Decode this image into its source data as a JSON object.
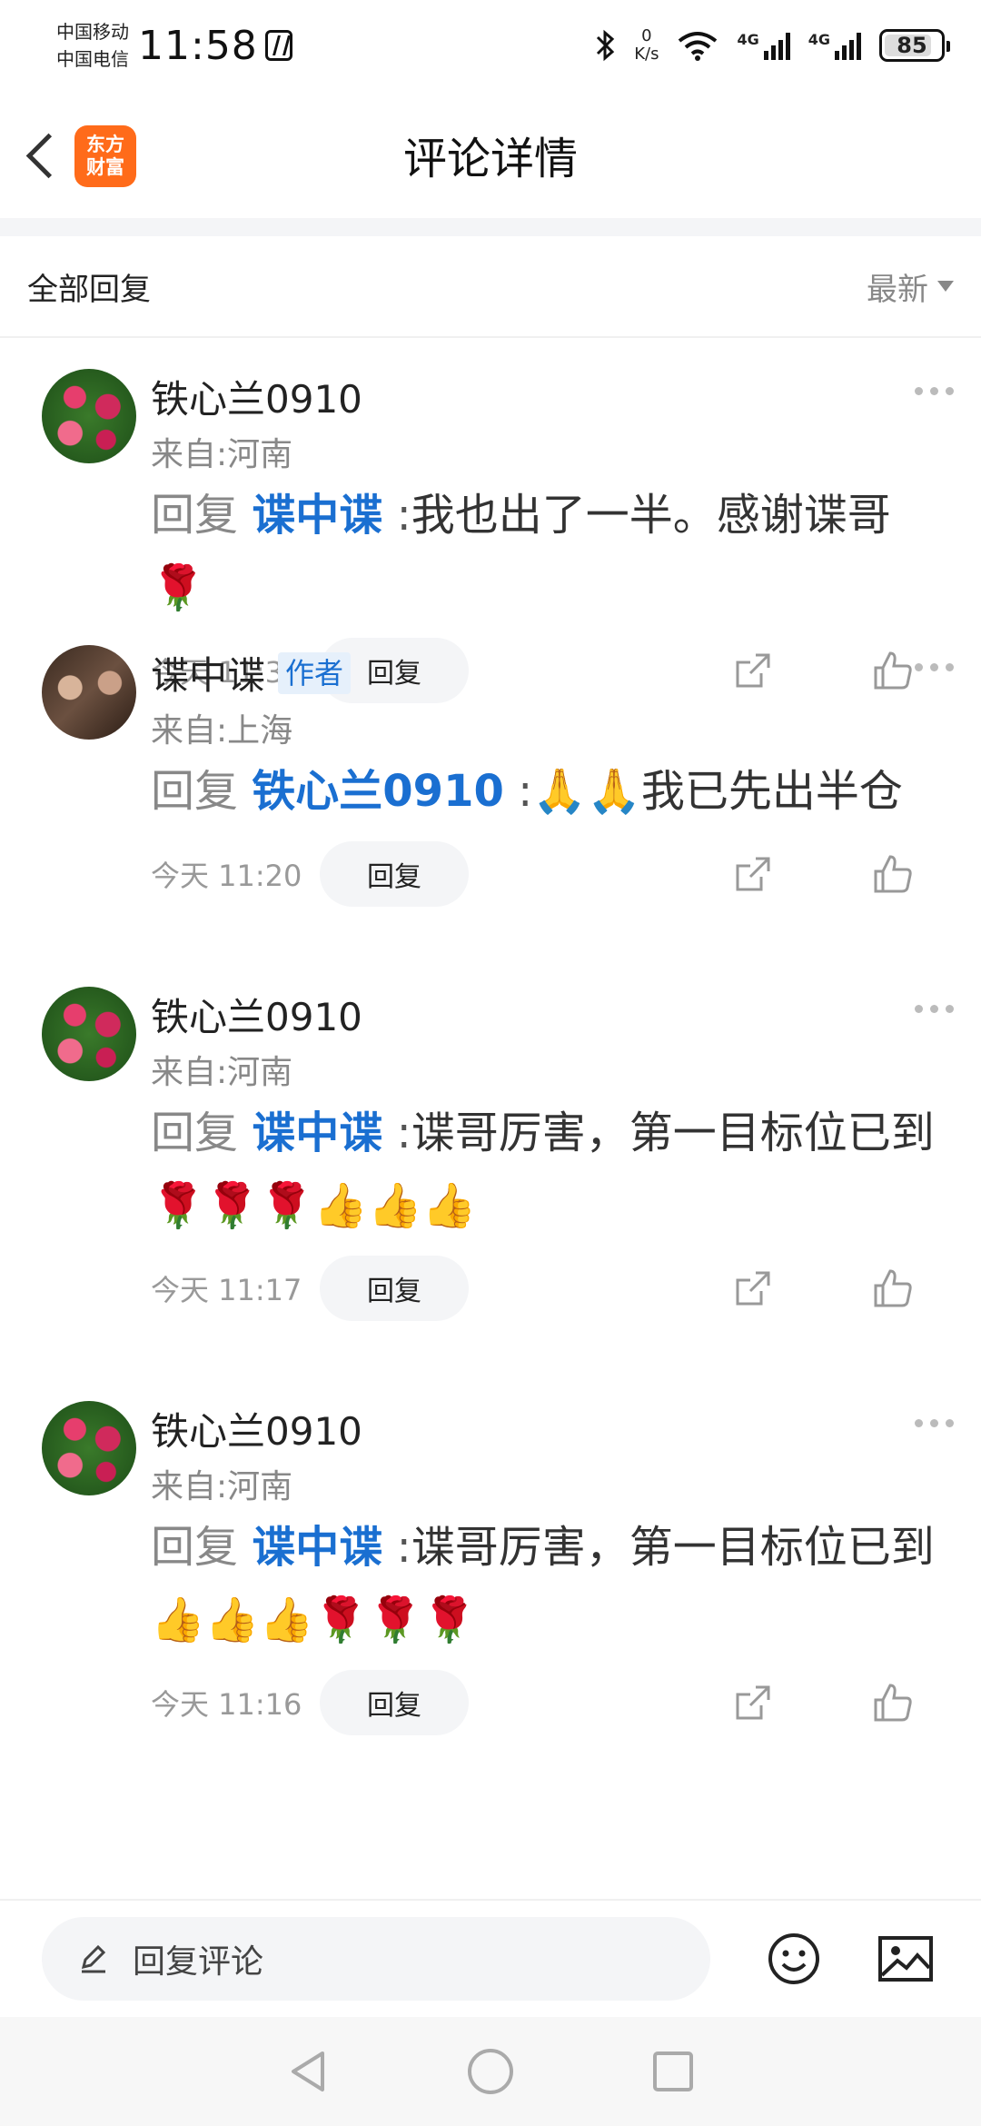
{
  "status_bar": {
    "carrier_1": "中国移动",
    "carrier_2": "中国电信",
    "time": "11:58",
    "net_speed_value": "0",
    "net_speed_unit": "K/s",
    "signal_1_tag": "4G",
    "signal_2_tag": "4G",
    "battery": "85",
    "battery_level": 0.85
  },
  "header": {
    "logo_line_1": "东方",
    "logo_line_2": "财富",
    "title": "评论详情"
  },
  "section": {
    "title": "全部回复",
    "sort_label": "最新"
  },
  "comments": [
    {
      "username": "铁心兰0910",
      "author_tag": "",
      "origin": "来自:河南",
      "reply_word": "回复",
      "mention": "谍中谍",
      "colon": ":",
      "text": "我也出了一半。感谢谍哥🌹",
      "timestamp": "今天 11:32",
      "reply_label": "回复"
    },
    {
      "username": "谍中谍",
      "author_tag": "作者",
      "origin": "来自:上海",
      "reply_word": "回复",
      "mention": "铁心兰0910",
      "colon": ":",
      "text": "🙏🙏我已先出半仓",
      "timestamp": "今天 11:20",
      "reply_label": "回复"
    },
    {
      "username": "铁心兰0910",
      "author_tag": "",
      "origin": "来自:河南",
      "reply_word": "回复",
      "mention": "谍中谍",
      "colon": ":",
      "text": "谍哥厉害，第一目标位已到🌹🌹🌹👍👍👍",
      "timestamp": "今天 11:17",
      "reply_label": "回复"
    },
    {
      "username": "铁心兰0910",
      "author_tag": "",
      "origin": "来自:河南",
      "reply_word": "回复",
      "mention": "谍中谍",
      "colon": ":",
      "text": "谍哥厉害，第一目标位已到👍👍👍🌹🌹🌹",
      "timestamp": "今天 11:16",
      "reply_label": "回复"
    }
  ],
  "input_bar": {
    "placeholder": "回复评论"
  },
  "colors": {
    "accent": "#1a6fd1",
    "brand": "#ff6b1a",
    "pill_bg": "#f4f5f7",
    "muted": "#888888"
  },
  "icons": [
    "back-icon",
    "share-icon",
    "like-icon",
    "more-icon",
    "pencil-icon",
    "emoji-icon",
    "image-icon",
    "nav-back-icon",
    "nav-home-icon",
    "nav-recents-icon"
  ]
}
